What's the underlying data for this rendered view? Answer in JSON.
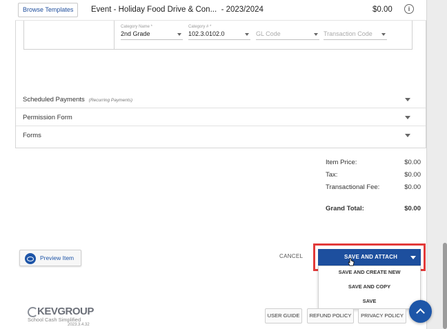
{
  "header": {
    "browse_templates": "Browse Templates",
    "title": "Event - Holiday Food Drive & Con...",
    "year": "- 2023/2024",
    "price": "$0.00",
    "info_icon": "info-icon"
  },
  "category": {
    "name_label": "Category Name *",
    "name_value": "2nd Grade",
    "number_label": "Category # *",
    "number_value": "102.3.0102.0",
    "gl_placeholder": "GL Code",
    "transaction_placeholder": "Transaction Code"
  },
  "sections": [
    {
      "title": "Scheduled Payments",
      "subtitle": "(Recurring Payments)"
    },
    {
      "title": "Permission Form",
      "subtitle": ""
    },
    {
      "title": "Forms",
      "subtitle": ""
    }
  ],
  "totals": {
    "item_price_label": "Item Price:",
    "item_price": "$0.00",
    "tax_label": "Tax:",
    "tax": "$0.00",
    "fee_label": "Transactional Fee:",
    "fee": "$0.00",
    "grand_label": "Grand Total:",
    "grand": "$0.00"
  },
  "actions": {
    "preview": "Preview Item",
    "cancel": "CANCEL",
    "save_attach": "SAVE AND ATTACH",
    "menu": [
      "SAVE AND CREATE NEW",
      "SAVE AND COPY",
      "SAVE"
    ]
  },
  "footer": {
    "logo": "KEVGROUP",
    "tagline": "School Cash Simplified",
    "version": "2023.3.4.32",
    "user_guide": "USER GUIDE",
    "refund_policy": "REFUND POLICY",
    "privacy_policy": "PRIVACY POLICY"
  },
  "colors": {
    "primary": "#1d4f9e",
    "highlight": "#e23a3a"
  }
}
